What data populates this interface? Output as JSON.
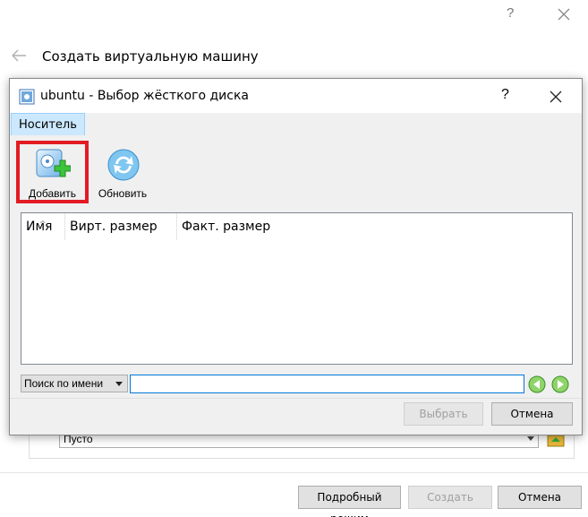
{
  "outer": {
    "help": "?",
    "title": "Создать виртуальную машину",
    "empty_value": "Пусто",
    "buttons": {
      "expert": "Подробный режим",
      "create": "Создать",
      "cancel": "Отмена"
    }
  },
  "dialog": {
    "title": "ubuntu - Выбор жёсткого диска",
    "help": "?",
    "menu": [
      "Носитель"
    ],
    "toolbar": {
      "add": "Добавить",
      "refresh": "Обновить"
    },
    "columns": [
      "Имя",
      "Вирт. размер",
      "Факт. размер"
    ],
    "search": {
      "mode": "Поиск по имени",
      "value": ""
    },
    "buttons": {
      "choose": "Выбрать",
      "cancel": "Отмена"
    }
  },
  "colors": {
    "highlight_border": "#e31b23",
    "menu_active": "#cce8ff",
    "focus_border": "#0078d7"
  }
}
